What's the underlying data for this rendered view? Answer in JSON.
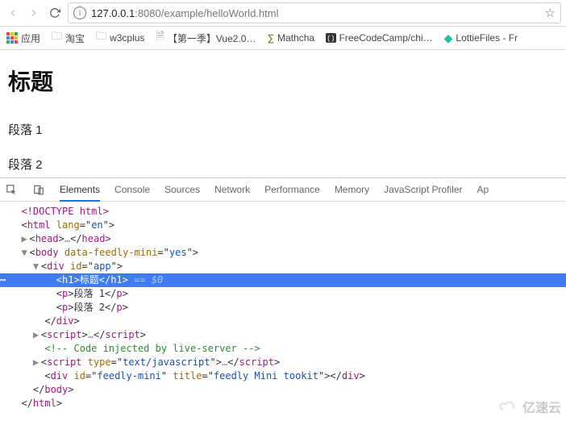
{
  "browser": {
    "url_host": "127.0.0.1",
    "url_port": ":8080",
    "url_path": "/example/helloWorld.html"
  },
  "bookmarks": {
    "apps": "应用",
    "taobao": "淘宝",
    "w3cplus": "w3cplus",
    "vue": "【第一季】Vue2.0…",
    "mathcha": "Mathcha",
    "fcc": "FreeCodeCamp/chi…",
    "lottie": "LottieFiles - Fr"
  },
  "page": {
    "title": "标题",
    "p1": "段落 1",
    "p2": "段落 2"
  },
  "devtools": {
    "tabs": {
      "elements": "Elements",
      "console": "Console",
      "sources": "Sources",
      "network": "Network",
      "performance": "Performance",
      "memory": "Memory",
      "jsprofiler": "JavaScript Profiler",
      "app": "Ap"
    }
  },
  "dom": {
    "doctype": "<!DOCTYPE html>",
    "html_open": "html",
    "html_lang_name": "lang",
    "html_lang_val": "en",
    "head_open": "head",
    "head_ell": "…",
    "head_close": "head",
    "body_open": "body",
    "body_attr_name": "data-feedly-mini",
    "body_attr_val": "yes",
    "div_open": "div",
    "div_id_name": "id",
    "div_id_val": "app",
    "h1_open": "h1",
    "h1_text": "标题",
    "h1_close": "h1",
    "h1_suffix": " == $0",
    "p1_open": "p",
    "p1_text": "段落 1",
    "p1_close": "p",
    "p2_open": "p",
    "p2_text": "段落 2",
    "p2_close": "p",
    "div_close": "div",
    "script1_open": "script",
    "script1_ell": "…",
    "script1_close": "script",
    "comment": "<!-- Code injected by live-server -->",
    "script2_open": "script",
    "script2_type_name": "type",
    "script2_type_val": "text/javascript",
    "script2_ell": "…",
    "script2_close": "script",
    "feedly_div_open": "div",
    "feedly_id_name": "id",
    "feedly_id_val": "feedly-mini",
    "feedly_title_name": "title",
    "feedly_title_val": "feedly Mini tookit",
    "feedly_div_close": "div",
    "body_close": "body",
    "html_close": "html"
  },
  "watermark": "亿速云"
}
